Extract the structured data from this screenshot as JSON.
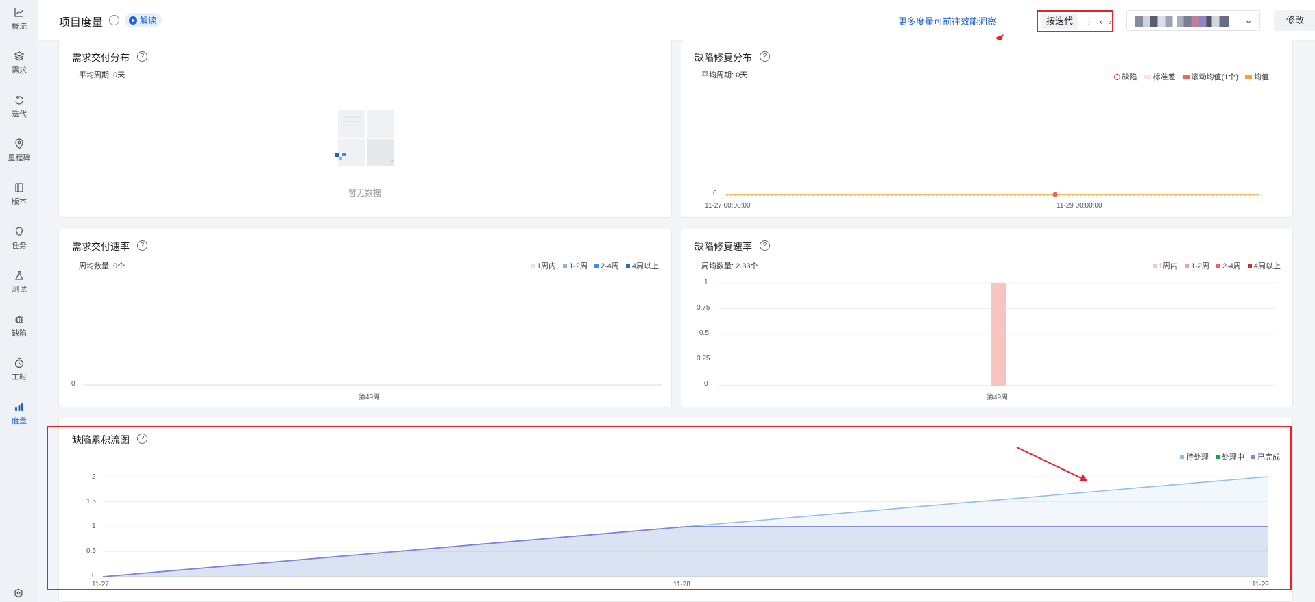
{
  "nav": [
    {
      "label": "概流",
      "icon": "trend-chart-icon"
    },
    {
      "label": "需求",
      "icon": "layers-icon"
    },
    {
      "label": "迭代",
      "icon": "refresh-cycle-icon"
    },
    {
      "label": "里程碑",
      "icon": "location-pin-icon"
    },
    {
      "label": "版本",
      "icon": "book-icon"
    },
    {
      "label": "任务",
      "icon": "lightbulb-icon"
    },
    {
      "label": "测试",
      "icon": "flask-icon"
    },
    {
      "label": "缺陷",
      "icon": "bug-icon"
    },
    {
      "label": "工时",
      "icon": "timer-icon"
    },
    {
      "label": "度量",
      "icon": "bar-chart-icon"
    }
  ],
  "header": {
    "title": "项目度量",
    "info_glyph": "i",
    "jiedu_label": "解读",
    "more_link": "更多度量可前往效能洞察",
    "iteration_select": "按迭代",
    "iter_more_glyph": "⋮",
    "prev_glyph": "‹",
    "next_glyph": "›",
    "dropdown_chevron": "⌄",
    "edit_label": "修改",
    "more_glyph": "···"
  },
  "help_glyph": "?",
  "cards": {
    "req_dist": {
      "title": "需求交付分布",
      "subtitle": "平均周期: 0天",
      "empty_text": "暂无数据"
    },
    "bug_dist": {
      "title": "缺陷修复分布",
      "subtitle": "平均周期: 0天",
      "legend": [
        "缺陷",
        "标准差",
        "滚动均值(1个)",
        "均值"
      ],
      "y_tick": "0",
      "x_ticks": [
        "11-27 00:00:00",
        "11-29 00:00:00"
      ]
    },
    "req_rate": {
      "title": "需求交付速率",
      "subtitle": "周均数量: 0个",
      "legend": [
        "1周内",
        "1-2周",
        "2-4周",
        "4周以上"
      ],
      "y_tick": "0",
      "x_tick": "第49周"
    },
    "bug_rate": {
      "title": "缺陷修复速率",
      "subtitle": "周均数量: 2.33个",
      "legend": [
        "1周内",
        "1-2周",
        "2-4周",
        "4周以上"
      ],
      "y_ticks": [
        "1",
        "0.75",
        "0.5",
        "0.25",
        "0"
      ],
      "x_tick": "第49周"
    },
    "cfd": {
      "title": "缺陷累积流图",
      "legend": [
        "待处理",
        "处理中",
        "已完成"
      ],
      "y_ticks": [
        "2",
        "1.5",
        "1",
        "0.5",
        "0"
      ],
      "x_ticks": [
        "11-27",
        "11-28",
        "11-29"
      ]
    }
  },
  "colors": {
    "accent": "#1f5fd1",
    "highlight_red": "#e5222a",
    "pending": "#8fbdf0",
    "in_progress": "#1aa34a",
    "done": "#8a7de6",
    "bug_rate_1w": "#f8c4c0",
    "bug_rate_1_2w": "#f3a39c",
    "bug_rate_2_4w": "#e8675f",
    "bug_rate_4w": "#c8342c",
    "req_rate_1w": "#d6e6fb",
    "req_rate_1_2w": "#7fb6ee",
    "req_rate_2_4w": "#3f8fdc",
    "req_rate_4w": "#1f6fc2"
  },
  "chart_data": [
    {
      "type": "scatter",
      "title": "缺陷修复分布",
      "x": [
        "11-27 00:00:00",
        "11-29 00:00:00"
      ],
      "series": [
        {
          "name": "缺陷",
          "values": [
            0
          ]
        },
        {
          "name": "滚动均值(1个)",
          "values": [
            0,
            0
          ]
        },
        {
          "name": "均值",
          "values": [
            0,
            0
          ]
        }
      ]
    },
    {
      "type": "bar",
      "title": "需求交付速率",
      "categories": [
        "第49周"
      ],
      "series": [
        {
          "name": "1周内",
          "values": [
            0
          ]
        },
        {
          "name": "1-2周",
          "values": [
            0
          ]
        },
        {
          "name": "2-4周",
          "values": [
            0
          ]
        },
        {
          "name": "4周以上",
          "values": [
            0
          ]
        }
      ]
    },
    {
      "type": "bar",
      "title": "缺陷修复速率",
      "categories": [
        "第49周"
      ],
      "ylim": [
        0,
        1
      ],
      "series": [
        {
          "name": "1周内",
          "values": [
            1
          ]
        },
        {
          "name": "1-2周",
          "values": [
            0
          ]
        },
        {
          "name": "2-4周",
          "values": [
            0
          ]
        },
        {
          "name": "4周以上",
          "values": [
            0
          ]
        }
      ]
    },
    {
      "type": "area",
      "title": "缺陷累积流图",
      "categories": [
        "11-27",
        "11-28",
        "11-29"
      ],
      "ylim": [
        0,
        2
      ],
      "series": [
        {
          "name": "待处理",
          "values": [
            0,
            1,
            2
          ]
        },
        {
          "name": "处理中",
          "values": [
            0,
            1,
            1
          ]
        },
        {
          "name": "已完成",
          "values": [
            0,
            1,
            1
          ]
        }
      ]
    }
  ]
}
